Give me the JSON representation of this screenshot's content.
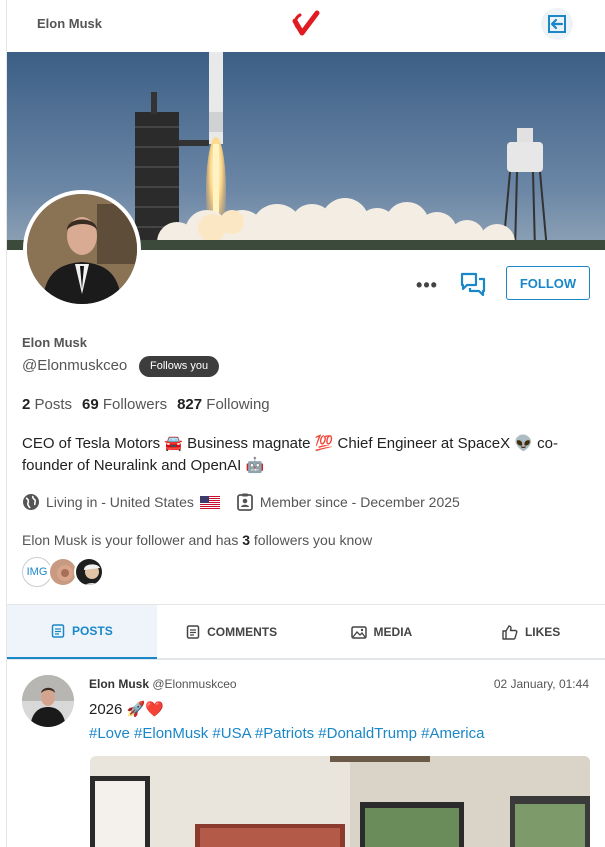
{
  "header": {
    "title": "Elon Musk"
  },
  "profile": {
    "name": "Elon Musk",
    "handle": "@Elonmuskceo",
    "follows_you": "Follows you",
    "follow_label": "FOLLOW",
    "more_label": "•••",
    "stats": {
      "posts_count": "2",
      "posts_label": "Posts",
      "followers_count": "69",
      "followers_label": "Followers",
      "following_count": "827",
      "following_label": "Following"
    },
    "bio": "CEO of Tesla Motors 🚘 Business magnate 💯 Chief Engineer at SpaceX 👽 co-founder of Neuralink and OpenAI 🤖",
    "location": "Living in - United States",
    "member_since": "Member since - December 2025",
    "mutual_prefix": "Elon Musk is your follower and has",
    "mutual_count": "3",
    "mutual_suffix": "followers you know",
    "mutual_avatar_text": "IMG"
  },
  "tabs": [
    {
      "label": "POSTS",
      "icon": "document-icon",
      "active": true
    },
    {
      "label": "COMMENTS",
      "icon": "comment-document-icon",
      "active": false
    },
    {
      "label": "MEDIA",
      "icon": "image-icon",
      "active": false
    },
    {
      "label": "LIKES",
      "icon": "thumbs-up-icon",
      "active": false
    }
  ],
  "post": {
    "author_name": "Elon Musk",
    "author_handle": "@Elonmuskceo",
    "timestamp": "02 January, 01:44",
    "text": "2026 🚀❤️",
    "hashtags": "#Love #ElonMusk #USA #Patriots #DonaldTrump #America"
  },
  "colors": {
    "accent": "#1a87c9",
    "badge_bg": "#3d3d3d",
    "logo_red": "#e01b22"
  }
}
